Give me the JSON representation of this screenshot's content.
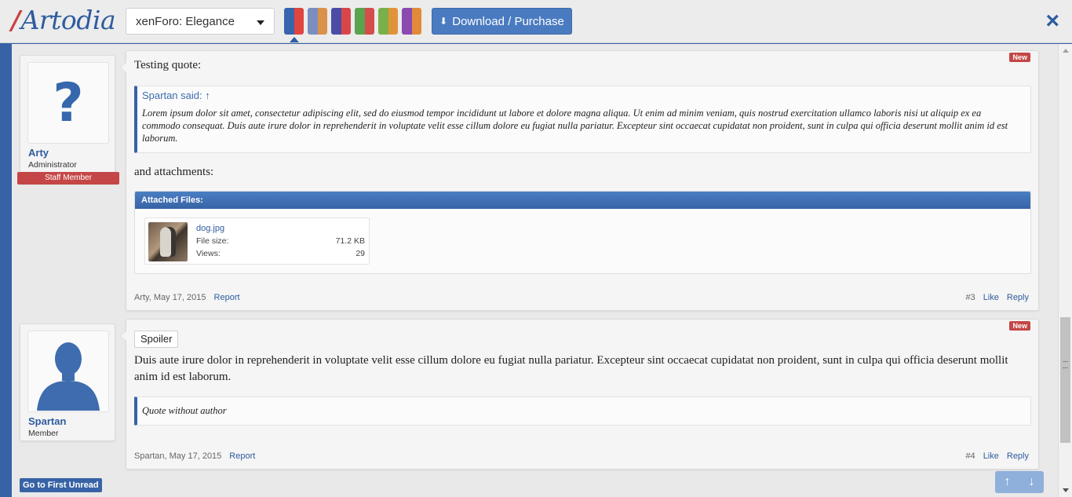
{
  "header": {
    "logo_slash": "/",
    "logo_text": "Artodia",
    "theme_select_value": "xenForo: Elegance",
    "download_label": "Download / Purchase",
    "close_icon": "×",
    "swatches": [
      [
        "#3665ae",
        "#e0443f"
      ],
      [
        "#7a8fc0",
        "#d9914b"
      ],
      [
        "#4b4ca6",
        "#d9464a"
      ],
      [
        "#5aa34f",
        "#d44d4a"
      ],
      [
        "#79b049",
        "#e0943a"
      ],
      [
        "#8a4ab0",
        "#e08a3a"
      ]
    ]
  },
  "posts": [
    {
      "username": "Arty",
      "user_title": "Administrator",
      "banner": "Staff Member",
      "new_badge": "New",
      "intro": "Testing quote:",
      "quote_author": "Spartan said: ↑",
      "quote_body": "Lorem ipsum dolor sit amet, consectetur adipiscing elit, sed do eiusmod tempor incididunt ut labore et dolore magna aliqua. Ut enim ad minim veniam, quis nostrud exercitation ullamco laboris nisi ut aliquip ex ea commodo consequat. Duis aute irure dolor in reprehenderit in voluptate velit esse cillum dolore eu fugiat nulla pariatur. Excepteur sint occaecat cupidatat non proident, sunt in culpa qui officia deserunt mollit anim id est laborum.",
      "after_text": "and attachments:",
      "attachments_header": "Attached Files:",
      "file_name": "dog.jpg",
      "file_size_label": "File size:",
      "file_size": "71.2 KB",
      "views_label": "Views:",
      "views": "29",
      "footer_author_date": "Arty, May 17, 2015",
      "report": "Report",
      "post_number": "#3",
      "like": "Like",
      "reply": "Reply"
    },
    {
      "username": "Spartan",
      "user_title": "Member",
      "new_badge": "New",
      "spoiler": "Spoiler",
      "body": "Duis aute irure dolor in reprehenderit in voluptate velit esse cillum dolore eu fugiat nulla pariatur. Excepteur sint occaecat cupidatat non proident, sunt in culpa qui officia deserunt mollit anim id est laborum.",
      "quote_body": "Quote without author",
      "footer_author_date": "Spartan, May 17, 2015",
      "report": "Report",
      "post_number": "#4",
      "like": "Like",
      "reply": "Reply"
    }
  ],
  "bottom": {
    "first_unread": "Go to First Unread",
    "up_arrow": "↑",
    "down_arrow": "↓"
  }
}
